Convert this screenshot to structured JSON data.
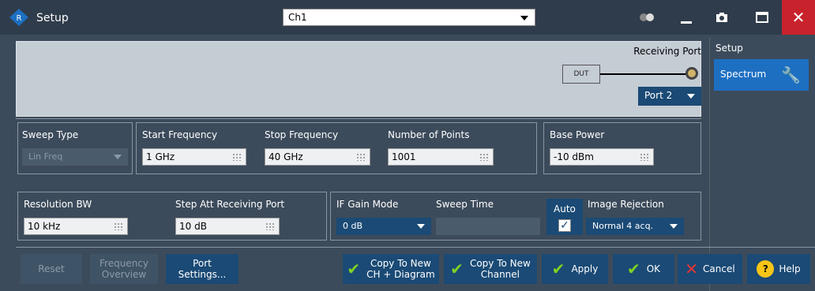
{
  "window": {
    "title": "Setup",
    "channel": "Ch1"
  },
  "diagram": {
    "dut": "DUT",
    "receiving_port_label": "Receiving Port",
    "port_value": "Port 2"
  },
  "side": {
    "setup_label": "Setup",
    "spectrum_label": "Spectrum"
  },
  "sweep_type": {
    "label": "Sweep Type",
    "value": "Lin Freq"
  },
  "start_freq": {
    "label": "Start Frequency",
    "value": "1 GHz"
  },
  "stop_freq": {
    "label": "Stop Frequency",
    "value": "40 GHz"
  },
  "num_points": {
    "label": "Number of Points",
    "value": "1001"
  },
  "base_power": {
    "label": "Base Power",
    "value": "-10 dBm"
  },
  "res_bw": {
    "label": "Resolution BW",
    "value": "10 kHz"
  },
  "step_att": {
    "label": "Step Att Receiving Port",
    "value": "10 dB"
  },
  "if_gain": {
    "label": "IF Gain Mode",
    "value": "0 dB"
  },
  "sweep_time": {
    "label": "Sweep Time",
    "value": ""
  },
  "auto": {
    "label": "Auto",
    "checked": true
  },
  "image_rej": {
    "label": "Image Rejection",
    "value": "Normal 4 acq."
  },
  "buttons": {
    "reset": "Reset",
    "freq_overview_1": "Frequency",
    "freq_overview_2": "Overview",
    "port_settings_1": "Port",
    "port_settings_2": "Settings...",
    "copy_ch_diag_1": "Copy To New",
    "copy_ch_diag_2": "CH + Diagram",
    "copy_ch_1": "Copy To New",
    "copy_ch_2": "Channel",
    "apply": "Apply",
    "ok": "OK",
    "cancel": "Cancel",
    "help": "Help"
  },
  "colors": {
    "accent": "#1d6fc2",
    "check": "#7ed321",
    "close": "#c8232c"
  }
}
